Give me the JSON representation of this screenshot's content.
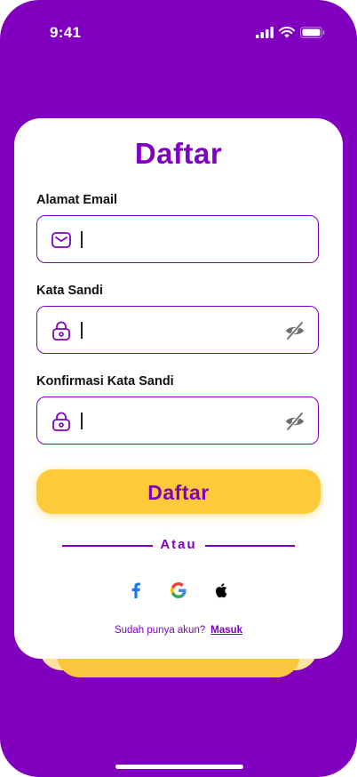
{
  "status_bar": {
    "time": "9:41"
  },
  "form": {
    "title": "Daftar",
    "email": {
      "label": "Alamat Email",
      "value": ""
    },
    "password": {
      "label": "Kata Sandi",
      "value": ""
    },
    "confirm_password": {
      "label": "Konfirmasi Kata Sandi",
      "value": ""
    },
    "submit_label": "Daftar",
    "divider_text": "Atau",
    "footer": {
      "text": "Sudah punya akun?",
      "link": "Masuk"
    }
  },
  "colors": {
    "primary": "#8100BF",
    "accent": "#FFCA3A",
    "background": "#8100BF",
    "card": "#FFFFFF"
  },
  "icons": {
    "email": "envelope-icon",
    "lock": "lock-icon",
    "visibility": "eye-off-icon",
    "social": [
      "facebook-icon",
      "google-icon",
      "apple-icon"
    ]
  }
}
